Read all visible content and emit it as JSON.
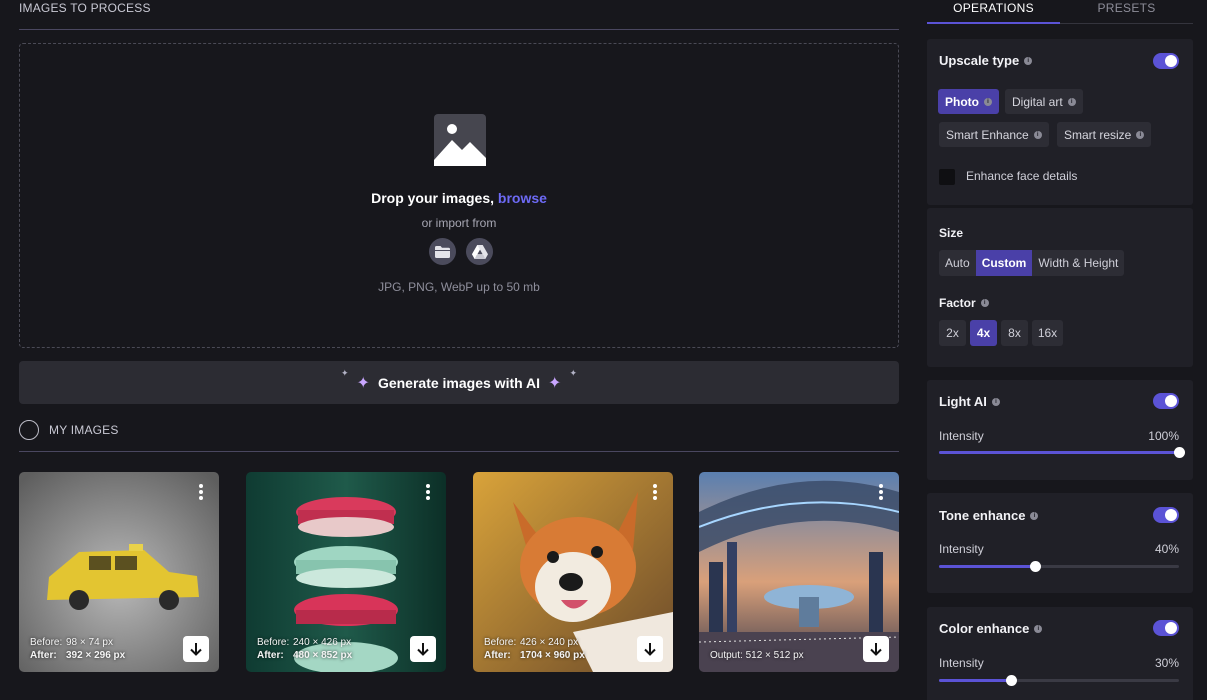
{
  "left": {
    "images_to_process_title": "IMAGES TO PROCESS",
    "dropzone": {
      "drop_text": "Drop your images,",
      "browse_link": "browse",
      "import_text": "or import from",
      "formats_text": "JPG, PNG, WebP up to 50 mb"
    },
    "generate_button": "Generate images with AI",
    "my_images_title": "MY IMAGES",
    "images": [
      {
        "before_label": "Before:",
        "before_value": "98 × 74 px",
        "after_label": "After:",
        "after_value": "392 × 296 px"
      },
      {
        "before_label": "Before:",
        "before_value": "240 × 426 px",
        "after_label": "After:",
        "after_value": "480 × 852 px"
      },
      {
        "before_label": "Before:",
        "before_value": "426 × 240 px",
        "after_label": "After:",
        "after_value": "1704 × 960 px"
      },
      {
        "output_text": "Output: 512 × 512 px"
      }
    ]
  },
  "right": {
    "tabs": [
      {
        "label": "OPERATIONS",
        "active": true
      },
      {
        "label": "PRESETS",
        "active": false
      }
    ],
    "upscale": {
      "title": "Upscale type",
      "enabled": true,
      "types": [
        {
          "label": "Photo",
          "active": true
        },
        {
          "label": "Digital art",
          "active": false
        },
        {
          "label": "Smart Enhance",
          "active": false
        },
        {
          "label": "Smart resize",
          "active": false
        }
      ],
      "enhance_face_label": "Enhance face details",
      "enhance_face_checked": false
    },
    "size": {
      "title": "Size",
      "options": [
        {
          "label": "Auto",
          "active": false
        },
        {
          "label": "Custom",
          "active": true
        },
        {
          "label": "Width & Height",
          "active": false
        }
      ],
      "factor_title": "Factor",
      "factors": [
        {
          "label": "2x",
          "active": false
        },
        {
          "label": "4x",
          "active": true
        },
        {
          "label": "8x",
          "active": false
        },
        {
          "label": "16x",
          "active": false
        }
      ]
    },
    "light_ai": {
      "title": "Light AI",
      "enabled": true,
      "intensity_label": "Intensity",
      "intensity_value": "100%",
      "intensity": 100
    },
    "tone_enhance": {
      "title": "Tone enhance",
      "enabled": true,
      "intensity_label": "Intensity",
      "intensity_value": "40%",
      "intensity": 40
    },
    "color_enhance": {
      "title": "Color enhance",
      "enabled": true,
      "intensity_label": "Intensity",
      "intensity_value": "30%",
      "intensity": 30
    }
  },
  "colors": {
    "accent": "#5b53d6",
    "accent_active_chip": "#4a40a8",
    "link": "#6d6af5",
    "background": "#17171c",
    "panel": "#202027"
  },
  "icons": [
    "image-icon",
    "folder-icon",
    "google-drive-icon",
    "sparkle-icon",
    "more-vertical-icon",
    "download-icon",
    "info-icon"
  ]
}
